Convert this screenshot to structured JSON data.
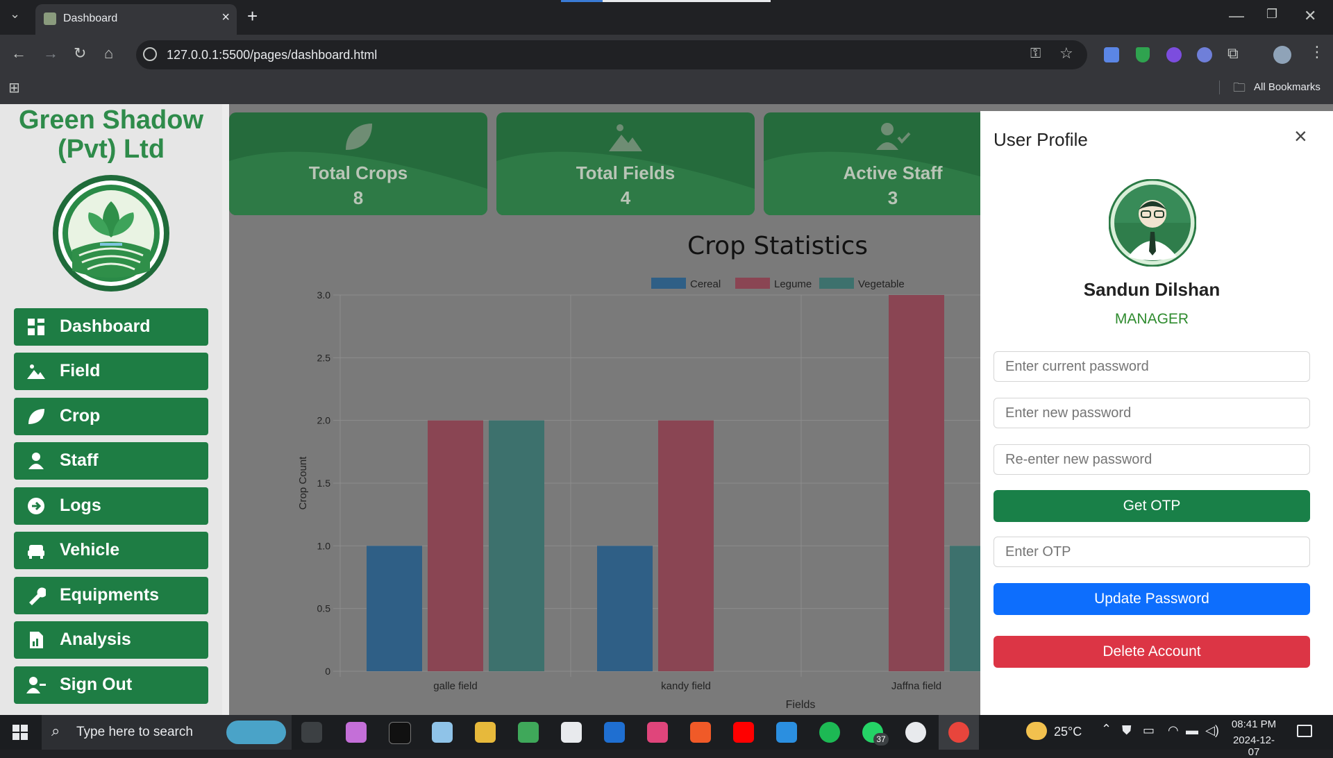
{
  "browser": {
    "tab_title": "Dashboard",
    "new_tab": "+",
    "url": "127.0.0.1:5500/pages/dashboard.html",
    "bookmarks_label": "All Bookmarks",
    "window_controls": [
      "minimize",
      "restore",
      "close"
    ]
  },
  "sidebar": {
    "brand": "Green Shadow (Pvt) Ltd",
    "items": [
      {
        "label": "Dashboard",
        "icon": "grid-icon"
      },
      {
        "label": "Field",
        "icon": "landscape-icon"
      },
      {
        "label": "Crop",
        "icon": "leaf-icon"
      },
      {
        "label": "Staff",
        "icon": "user-icon"
      },
      {
        "label": "Logs",
        "icon": "arrow-circle-icon"
      },
      {
        "label": "Vehicle",
        "icon": "car-icon"
      },
      {
        "label": "Equipments",
        "icon": "wrench-icon"
      },
      {
        "label": "Analysis",
        "icon": "report-icon"
      },
      {
        "label": "Sign Out",
        "icon": "user-minus-icon"
      }
    ]
  },
  "cards": [
    {
      "title": "Total Crops",
      "value": "8",
      "icon": "leaf-icon"
    },
    {
      "title": "Total Fields",
      "value": "4",
      "icon": "landscape-icon"
    },
    {
      "title": "Active Staff",
      "value": "3",
      "icon": "user-check-icon"
    }
  ],
  "chart_data": {
    "type": "bar",
    "title": "Crop Statistics",
    "xlabel": "Fields",
    "ylabel": "Crop Count",
    "categories": [
      "galle field",
      "kandy field",
      "Jaffna field"
    ],
    "series": [
      {
        "name": "Cereal",
        "values": [
          1,
          1,
          0
        ]
      },
      {
        "name": "Legume",
        "values": [
          2,
          2,
          3
        ]
      },
      {
        "name": "Vegetable",
        "values": [
          2,
          0,
          1
        ]
      }
    ],
    "ylim": [
      0,
      3.0
    ],
    "yticks": [
      "0",
      "0.5",
      "1.0",
      "1.5",
      "2.0",
      "2.5",
      "3.0"
    ],
    "colors": [
      "#2f5f86",
      "#8a4553",
      "#3d716d"
    ],
    "legend": "top-center",
    "grid": true
  },
  "profile": {
    "title": "User Profile",
    "name": "Sandun Dilshan",
    "role": "MANAGER",
    "current_password_placeholder": "Enter current password",
    "new_password_placeholder": "Enter new password",
    "reenter_password_placeholder": "Re-enter new password",
    "get_otp": "Get OTP",
    "otp_placeholder": "Enter OTP",
    "update_password": "Update Password",
    "delete_account": "Delete Account"
  },
  "taskbar": {
    "search_placeholder": "Type here to search",
    "weather": "25°C",
    "time": "08:41 PM",
    "date": "2024-12-07",
    "whatsapp_badge": "37"
  },
  "colors": {
    "sidebar_green": "#1e7d44",
    "brand_green": "#2e8b4a",
    "role_green": "#2e8b2e",
    "update_blue": "#0d6efd",
    "delete_red": "#dc3545"
  }
}
